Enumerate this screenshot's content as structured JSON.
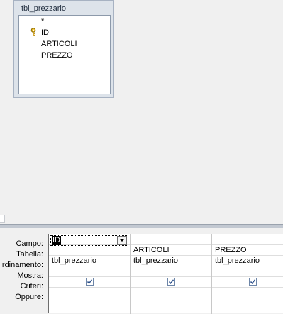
{
  "field_list": {
    "title": "tbl_prezzario",
    "fields": [
      "*",
      "ID",
      "ARTICOLI",
      "PREZZO"
    ],
    "primary_key_field": "ID"
  },
  "grid": {
    "row_labels": [
      "Campo:",
      "Tabella:",
      "rdinamento:",
      "Mostra:",
      "Criteri:",
      "Oppure:"
    ],
    "columns": [
      {
        "campo": "ID",
        "tabella": "tbl_prezzario",
        "mostra": true
      },
      {
        "campo": "ARTICOLI",
        "tabella": "tbl_prezzario",
        "mostra": true
      },
      {
        "campo": "PREZZO",
        "tabella": "tbl_prezzario",
        "mostra": true
      }
    ]
  },
  "icons": {
    "key": "key-icon",
    "dropdown": "chevron-down-icon",
    "checkbox": "checkmark-icon"
  },
  "colors": {
    "panel_bg": "#dde3ea",
    "panel_border": "#a7b2c2",
    "grid_bg": "#ffffff",
    "check": "#2b4f8a"
  }
}
